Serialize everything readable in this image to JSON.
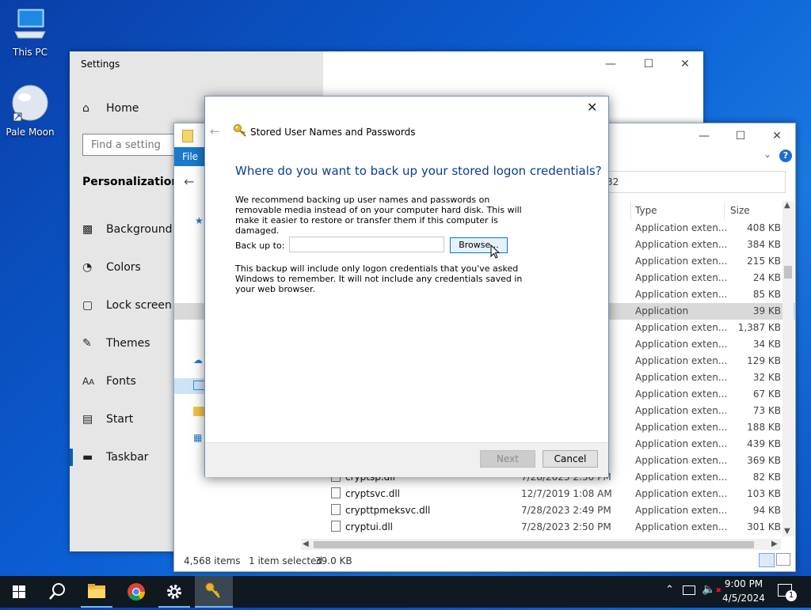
{
  "desktop": {
    "icons": [
      {
        "label": "This PC",
        "icon": "computer-icon"
      },
      {
        "label": "Pale Moon",
        "icon": "pale-moon-icon"
      }
    ]
  },
  "settings": {
    "title": "Settings",
    "home": "Home",
    "search_placeholder": "Find a setting",
    "section": "Personalization",
    "nav": [
      {
        "label": "Background",
        "icon": "image-icon"
      },
      {
        "label": "Colors",
        "icon": "palette-icon"
      },
      {
        "label": "Lock screen",
        "icon": "monitor-icon"
      },
      {
        "label": "Themes",
        "icon": "brush-icon"
      },
      {
        "label": "Fonts",
        "icon": "font-icon"
      },
      {
        "label": "Start",
        "icon": "start-icon"
      },
      {
        "label": "Taskbar",
        "icon": "taskbar-icon"
      }
    ]
  },
  "explorer": {
    "ribbon_file": "File",
    "address_tail": "32",
    "columns": {
      "type": "Type",
      "size": "Size"
    },
    "rows": [
      {
        "name": "",
        "date": "",
        "type": "Application exten...",
        "size": "408 KB"
      },
      {
        "name": "",
        "date": "",
        "type": "Application exten...",
        "size": "384 KB"
      },
      {
        "name": "",
        "date": "",
        "type": "Application exten...",
        "size": "215 KB"
      },
      {
        "name": "",
        "date": "",
        "type": "Application exten...",
        "size": "24 KB"
      },
      {
        "name": "",
        "date": "",
        "type": "Application exten...",
        "size": "85 KB"
      },
      {
        "name": "",
        "date": "",
        "type": "Application",
        "size": "39 KB",
        "selected": true
      },
      {
        "name": "",
        "date": "",
        "type": "Application exten...",
        "size": "1,387 KB"
      },
      {
        "name": "",
        "date": "",
        "type": "Application exten...",
        "size": "34 KB"
      },
      {
        "name": "",
        "date": "",
        "type": "Application exten...",
        "size": "129 KB"
      },
      {
        "name": "",
        "date": "",
        "type": "Application exten...",
        "size": "32 KB"
      },
      {
        "name": "",
        "date": "",
        "type": "Application exten...",
        "size": "67 KB"
      },
      {
        "name": "",
        "date": "",
        "type": "Application exten...",
        "size": "73 KB"
      },
      {
        "name": "",
        "date": "",
        "type": "Application exten...",
        "size": "188 KB"
      },
      {
        "name": "",
        "date": "",
        "type": "Application exten...",
        "size": "439 KB"
      },
      {
        "name": "",
        "date": "",
        "type": "Application exten...",
        "size": "369 KB"
      },
      {
        "name": "cryptsp.dll",
        "date": "7/28/2023 2:50 PM",
        "type": "Application exten...",
        "size": "82 KB"
      },
      {
        "name": "cryptsvc.dll",
        "date": "12/7/2019 1:08 AM",
        "type": "Application exten...",
        "size": "103 KB"
      },
      {
        "name": "crypttpmeksvc.dll",
        "date": "7/28/2023 2:49 PM",
        "type": "Application exten...",
        "size": "94 KB"
      },
      {
        "name": "cryptui.dll",
        "date": "7/28/2023 2:50 PM",
        "type": "Application exten...",
        "size": "301 KB"
      }
    ],
    "status_items": "4,568 items",
    "status_selected": "1 item selected",
    "status_size": "39.0 KB"
  },
  "dialog": {
    "title": "Stored User Names and Passwords",
    "heading": "Where do you want to back up your stored logon credentials?",
    "intro": "We recommend backing up user names and passwords on removable media instead of on your computer hard disk. This will make it easier to restore or transfer them if this computer is damaged.",
    "backup_label": "Back up to:",
    "backup_value": "",
    "browse": "Browse...",
    "note": "This backup will include only logon credentials that you've asked Windows to remember. It will not include any credentials saved in your web browser.",
    "next": "Next",
    "cancel": "Cancel"
  },
  "taskbar": {
    "time": "9:00 PM",
    "date": "4/5/2024",
    "notification_count": "1"
  },
  "colors": {
    "accent": "#0063b1",
    "heading_blue": "#0b3d91"
  }
}
